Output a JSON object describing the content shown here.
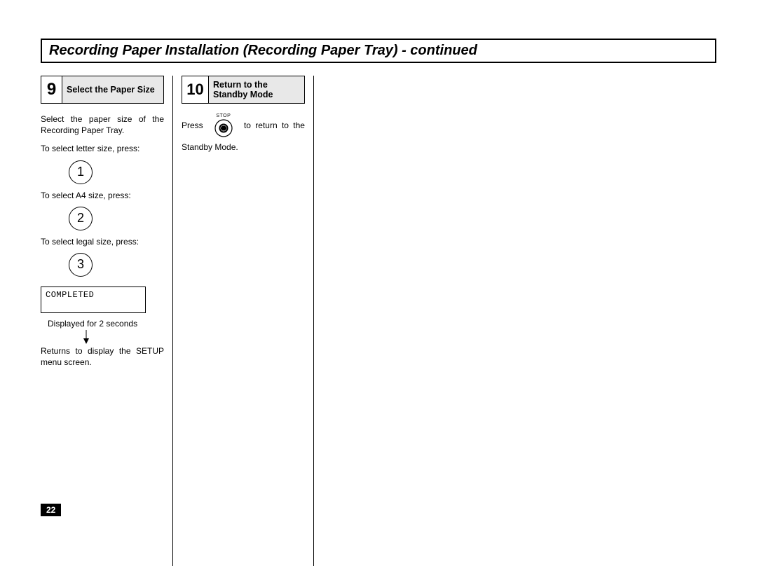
{
  "page_number": "22",
  "title": "Recording Paper Installation (Recording Paper Tray) - continued",
  "step9": {
    "num": "9",
    "title": "Select the Paper Size",
    "intro": "Select the paper size of the Recording Paper Tray.",
    "letter_prompt": "To select letter size, press:",
    "a4_prompt": "To select A4 size, press:",
    "legal_prompt": "To select legal size, press:",
    "btn1": "1",
    "btn2": "2",
    "btn3": "3",
    "lcd": "COMPLETED",
    "caption": "Displayed for 2 seconds",
    "returns": "Returns to display the SETUP menu screen."
  },
  "step10": {
    "num": "10",
    "title": "Return to the Standby Mode",
    "press": "Press",
    "stop_label": "STOP",
    "to_return": "to return to the",
    "standby": "Standby Mode."
  }
}
